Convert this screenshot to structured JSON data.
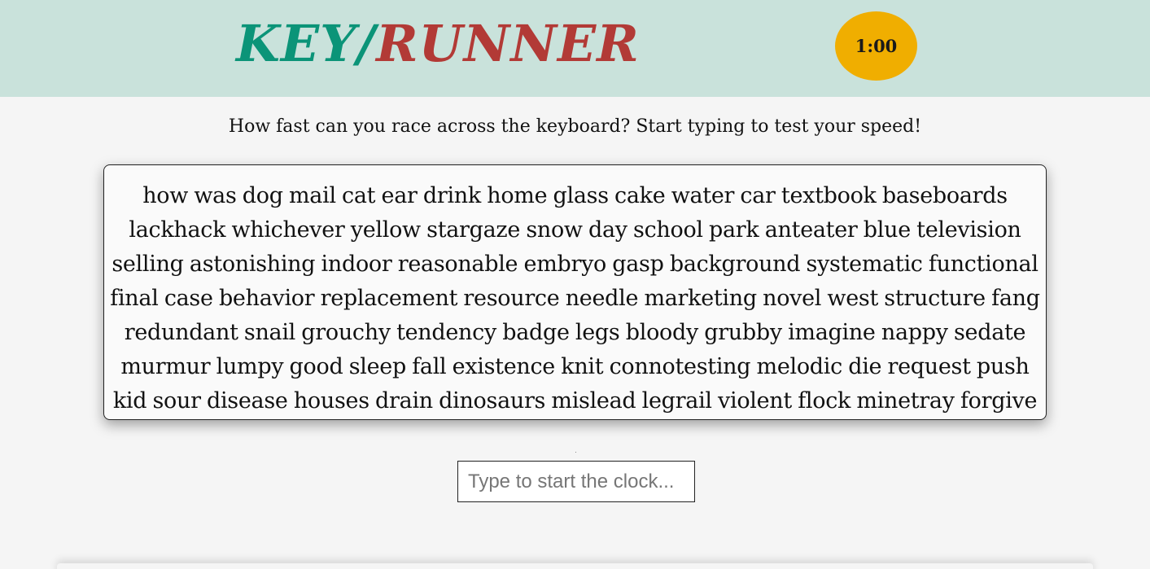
{
  "header": {
    "logo_key": "KEY",
    "logo_slash": "/",
    "logo_runner": "RUNNER",
    "timer": "1:00",
    "colors": {
      "background": "#c9e2db",
      "key": "#0b9478",
      "runner": "#b23a36",
      "timer": "#f0ae00"
    }
  },
  "main": {
    "tagline": "How fast can you race across the keyboard? Start typing to test your speed!",
    "words": "how was dog mail cat ear drink home glass cake water car textbook baseboards lackhack whichever yellow stargaze snow day school park anteater blue television selling astonishing indoor reasonable embryo gasp background systematic functional final case behavior replacement resource needle marketing novel west structure fang redundant snail grouchy tendency badge legs bloody grubby imagine nappy sedate murmur lumpy good sleep fall existence knit connotesting melodic die request push kid sour disease houses drain dinosaurs mislead legrail violent flock minetray forgive",
    "input": {
      "placeholder": "Type to start the clock...",
      "value": ""
    }
  }
}
